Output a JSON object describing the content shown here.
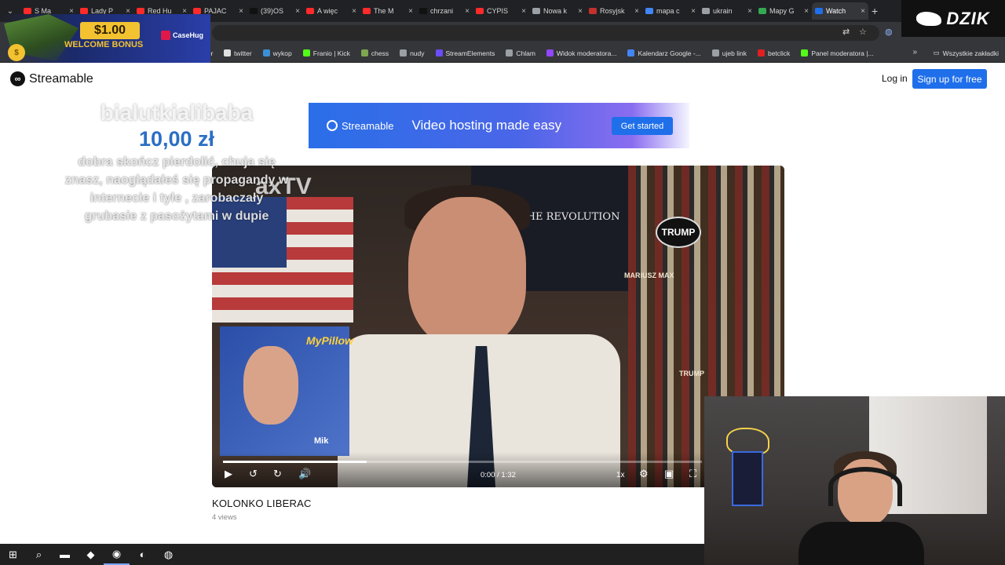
{
  "browser": {
    "tabs": [
      {
        "title": "S Ma",
        "color": "#ff2a2a",
        "active": false
      },
      {
        "title": "Lady P",
        "color": "#ff2a2a",
        "active": false
      },
      {
        "title": "Red Hu",
        "color": "#ff2a2a",
        "active": false
      },
      {
        "title": "PAJAC",
        "color": "#ff2a2a",
        "active": false
      },
      {
        "title": "(39)OS",
        "color": "#111111",
        "active": false
      },
      {
        "title": "A więc",
        "color": "#ff2a2a",
        "active": false
      },
      {
        "title": "The M",
        "color": "#ff2a2a",
        "active": false
      },
      {
        "title": "chrzani",
        "color": "#111111",
        "active": false
      },
      {
        "title": "CYPIS",
        "color": "#ff2a2a",
        "active": false
      },
      {
        "title": "Nowa k",
        "color": "#9aa0a6",
        "active": false
      },
      {
        "title": "Rosyjsk",
        "color": "#c4302b",
        "active": false
      },
      {
        "title": "mapa c",
        "color": "#4285f4",
        "active": false
      },
      {
        "title": "ukrain",
        "color": "#9aa0a6",
        "active": false
      },
      {
        "title": "Mapy G",
        "color": "#34a853",
        "active": false
      },
      {
        "title": "Watch",
        "color": "#1f6feb",
        "active": true
      }
    ],
    "new_tab_glyph": "+",
    "close_glyph": "×"
  },
  "bookmarks": {
    "items": [
      {
        "label": "twitter",
        "color": "#e0e0e0"
      },
      {
        "label": "wykop",
        "color": "#3b8fd4"
      },
      {
        "label": "Franio | Kick",
        "color": "#53fc18"
      },
      {
        "label": "chess",
        "color": "#7fa650"
      },
      {
        "label": "nudy",
        "color": "#9aa0a6"
      },
      {
        "label": "StreamElements",
        "color": "#6b4cff"
      },
      {
        "label": "Chlam",
        "color": "#9aa0a6"
      },
      {
        "label": "Widok moderatora...",
        "color": "#9146ff"
      },
      {
        "label": "Kalendarz Google -...",
        "color": "#4285f4"
      },
      {
        "label": "ujeb link",
        "color": "#9aa0a6"
      },
      {
        "label": "betclick",
        "color": "#e02020"
      },
      {
        "label": "Panel moderatora |...",
        "color": "#53fc18"
      }
    ],
    "all_bookmarks_label": "Wszystkie zakładki",
    "hidden_fragment": "ior"
  },
  "site": {
    "brand": "Streamable",
    "login_label": "Log in",
    "signup_label": "Sign up for free"
  },
  "banner": {
    "brand": "Streamable",
    "tagline": "Video hosting made easy",
    "cta": "Get started"
  },
  "video": {
    "title": "KOLONKO LIBERAC",
    "views": "4 views",
    "time": "0:00 / 1:32",
    "progress": 0.3,
    "speed": "1x",
    "overlay_brand": "axTV",
    "shirt_text": "THE REVOLUTION",
    "sign_text": "TRUMP",
    "book_text": "MARIUSZ MAX",
    "book_text2": "TRUMP",
    "inset_tag": "MyPillow",
    "inset_name": "Mik"
  },
  "donation": {
    "name": "bialutkialibaba",
    "amount": "10,00 zł",
    "message": "dobra skończ pierdolić, chuja się znasz, naoglądałeś się propagandy w internecie i tyle , zarobaczały grubasie z pasożytami w dupie"
  },
  "promo": {
    "amount": "$1.00",
    "bonus": "WELCOME BONUS",
    "brand": "CaseHug",
    "coin_glyph": "$"
  },
  "overlay": {
    "channel_logo": "DZIK"
  },
  "taskbar": {
    "items": [
      {
        "name": "start-button",
        "glyph": "⊞"
      },
      {
        "name": "search-button",
        "glyph": "⌕"
      },
      {
        "name": "file-explorer-button",
        "glyph": "▬"
      },
      {
        "name": "app-button-1",
        "glyph": "◆"
      },
      {
        "name": "chrome-button",
        "glyph": "◉"
      },
      {
        "name": "app-button-2",
        "glyph": "◐"
      },
      {
        "name": "app-button-3",
        "glyph": "◍"
      }
    ]
  },
  "icons": {
    "play": "play-icon",
    "rewind": "rewind-icon",
    "forward": "forward-icon",
    "volume": "volume-icon",
    "settings": "gear-icon",
    "pip": "picture-in-picture-icon",
    "fullscreen": "fullscreen-icon"
  },
  "colors": {
    "accent": "#1f6feb",
    "donation_amount": "#2b6fc4",
    "promo_gold": "#f2c230"
  }
}
